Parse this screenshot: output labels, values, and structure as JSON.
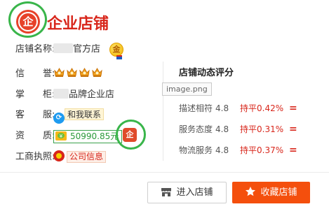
{
  "header": {
    "logo_icon": "enterprise-badge-icon",
    "logo_glyph": "企",
    "title": "企业店铺"
  },
  "info": {
    "shop_name_label": "店铺名称:",
    "shop_name_suffix": "官方店",
    "gold_badge_glyph": "金",
    "reputation_label": "信　　誉:",
    "reputation_crowns": 4,
    "owner_label": "掌　　柜:",
    "owner_suffix": "品牌企业店",
    "service_label": "客　　服:",
    "service_icon_glyph": "⟳",
    "chat_link": "和我联系",
    "qualification_label": "资　　质:",
    "deposit_amount": "50990.85元",
    "enterprise_glyph": "企",
    "license_label": "工商执照:",
    "company_info_link": "公司信息"
  },
  "rating": {
    "title": "店铺动态评分",
    "image_tooltip": "image.png",
    "rows": [
      {
        "name": "描述相符",
        "score": "4.8",
        "compare": "持平0.42%",
        "sign": "="
      },
      {
        "name": "服务态度",
        "score": "4.8",
        "compare": "持平0.31%",
        "sign": "="
      },
      {
        "name": "物流服务",
        "score": "4.8",
        "compare": "持平0.37%",
        "sign": "="
      }
    ]
  },
  "actions": {
    "enter_label": "进入店铺",
    "favorite_label": "收藏店铺"
  },
  "colors": {
    "brand_red": "#d8261b",
    "highlight_ring": "#39b54a",
    "favorite_button": "#f44f0d"
  }
}
